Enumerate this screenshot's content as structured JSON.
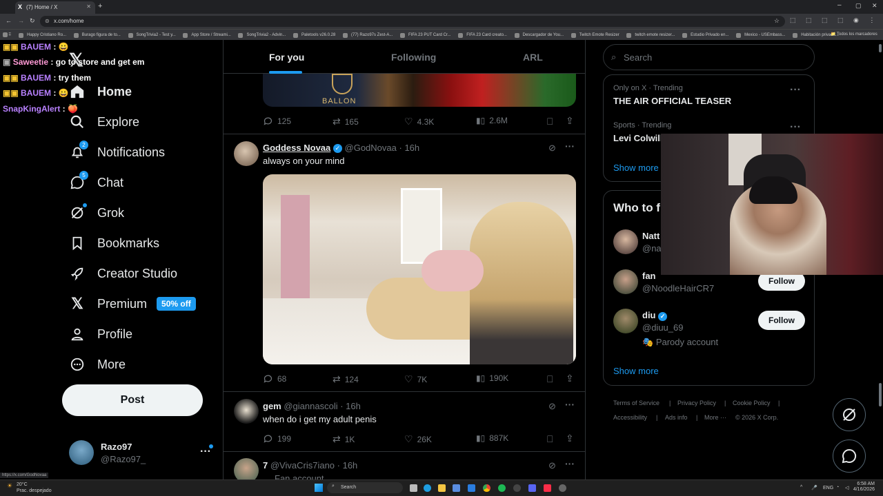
{
  "browser": {
    "tab_title": "(7) Home / X",
    "url": "x.com/home",
    "status_url": "https://x.com/GodNovaa",
    "bookmarks": [
      "Happy Cristiano Ro...",
      "Burago figura de to...",
      "SongTrivia2 - Test y...",
      "App Store / Streami...",
      "SongTrivia2 - Advin...",
      "Paletools v26.0.28",
      "(77) Razo97s Zest-A...",
      "FIFA 23 PUT Card Cr...",
      "FIFA 23 Card creato...",
      "Descargador de You...",
      "Twitch Emote Resizer",
      "twitch emote resizer...",
      "Estudio Privado en...",
      "Mexico - USEmbass...",
      "Habitación privada..."
    ],
    "bookmarks_folder": "Todos los marcadores"
  },
  "chat_overlay": [
    {
      "user": "BAUEM",
      "msg": "😀"
    },
    {
      "user": "Saweetie",
      "msg": "go to store and get em"
    },
    {
      "user": "BAUEM",
      "msg": "try them"
    },
    {
      "user": "BAUEM",
      "msg": "😀"
    },
    {
      "user": "SnapKingAlert",
      "msg": "🍑"
    }
  ],
  "nav": {
    "home": "Home",
    "explore": "Explore",
    "notifications": "Notifications",
    "notifications_badge": "2",
    "chat": "Chat",
    "chat_badge": "5",
    "grok": "Grok",
    "bookmarks": "Bookmarks",
    "creator_studio": "Creator Studio",
    "premium": "Premium",
    "premium_promo": "50% off",
    "profile": "Profile",
    "more": "More",
    "post_button": "Post",
    "account_name": "Razo97",
    "account_handle": "@Razo97_"
  },
  "feed": {
    "tabs": [
      "For you",
      "Following",
      "ARL"
    ],
    "prev_post": {
      "image_text": "BALLON",
      "replies": "125",
      "reposts": "165",
      "likes": "4.3K",
      "views": "2.6M"
    },
    "posts": [
      {
        "name": "Goddess Novaa",
        "handle": "@GodNovaa",
        "time": "16h",
        "text": "always on your mind",
        "replies": "68",
        "reposts": "124",
        "likes": "7K",
        "views": "190K"
      },
      {
        "name": "gem",
        "handle": "@giannascoli",
        "time": "16h",
        "text": "when do i get my adult penis",
        "replies": "199",
        "reposts": "1K",
        "likes": "26K",
        "views": "887K"
      },
      {
        "name": "7",
        "handle": "@VivaCris7iano",
        "time": "16h",
        "text": "Fan account"
      }
    ]
  },
  "sidebar": {
    "search_placeholder": "Search",
    "trends": [
      {
        "context": "Only on X · Trending",
        "title": "THE AIR OFFICIAL TEASER"
      },
      {
        "context": "Sports · Trending",
        "title": "Levi Colwill"
      }
    ],
    "show_more": "Show more",
    "who_to_follow_title": "Who to f",
    "suggestions": [
      {
        "name": "Natt",
        "handle": "@na"
      },
      {
        "name": "fan",
        "handle": "@NoodleHairCR7",
        "button": "Follow"
      },
      {
        "name": "diu",
        "handle": "@diuu_69",
        "note": "Parody account",
        "button": "Follow"
      }
    ],
    "show_more_2": "Show more",
    "footer": [
      "Terms of Service",
      "Privacy Policy",
      "Cookie Policy",
      "Accessibility",
      "Ads info",
      "More ···",
      "© 2026 X Corp."
    ]
  },
  "taskbar": {
    "weather_temp": "20°C",
    "weather_desc": "Prac. despejado",
    "search": "Search",
    "lang": "ENG",
    "time": "6:58 AM",
    "date": "4/16/2026"
  }
}
